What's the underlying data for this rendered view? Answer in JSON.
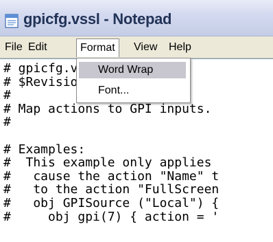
{
  "window": {
    "title": "gpicfg.vssl - Notepad",
    "icon": "notepad-icon"
  },
  "menubar": {
    "file": "File",
    "edit": "Edit",
    "format": "Format",
    "view": "View",
    "help": "Help"
  },
  "format_menu": {
    "open": true,
    "items": [
      {
        "label": "Word Wrap",
        "highlighted": true
      },
      {
        "label": "Font...",
        "highlighted": false
      }
    ]
  },
  "editor": {
    "lines": [
      "# gpicfg.vssl",
      "# $Revision",
      "#",
      "# Map actions to GPI inputs.",
      "#",
      "",
      "# Examples:",
      "#  This example only applies",
      "#   cause the action \"Name\" t",
      "#   to the action \"FullScreen",
      "#   obj GPISource (\"Local\") {",
      "#     obj gpi(7) { action = '"
    ]
  },
  "colors": {
    "menu_highlight": "#c8c6ce",
    "title_text": "#223358",
    "chrome": "#ece9d8"
  }
}
